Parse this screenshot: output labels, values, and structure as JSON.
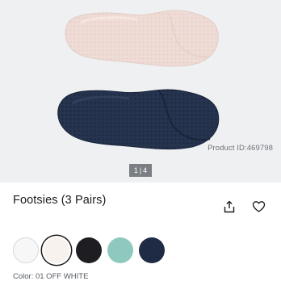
{
  "gallery": {
    "product_id": "Product ID:469798",
    "pager": {
      "current": "1",
      "separator": "|",
      "total": "4"
    }
  },
  "product": {
    "title": "Footsies (3 Pairs)",
    "share_icon": "share-icon",
    "favorite_icon": "heart-icon"
  },
  "colors": {
    "options": [
      {
        "name": "white",
        "hex": "#f7f7f7"
      },
      {
        "name": "off-white",
        "hex": "#f8f2ee",
        "selected": true
      },
      {
        "name": "black",
        "hex": "#1e1e22"
      },
      {
        "name": "mint",
        "hex": "#8fc9be"
      },
      {
        "name": "navy",
        "hex": "#1f2b45"
      }
    ],
    "label": "Color: 01 OFF WHITE"
  }
}
